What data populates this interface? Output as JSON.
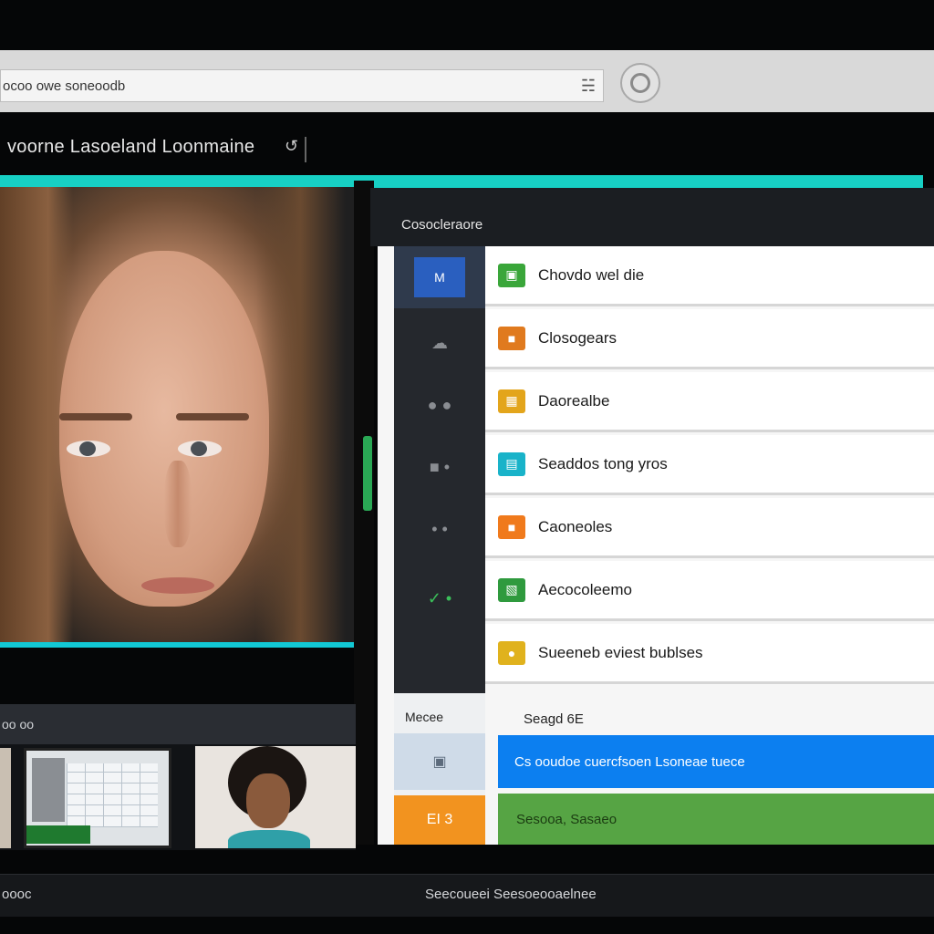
{
  "address_bar": {
    "text": "ocoo owe soneoodb"
  },
  "page_title": "voorne Lasoeland Loonmaine",
  "panel": {
    "header": "Cosocleraore",
    "items": [
      {
        "label": "Chovdo wel die",
        "icon": "green-card-icon",
        "color": "#3aa63a"
      },
      {
        "label": "Closogears",
        "icon": "folder-icon",
        "color": "#e07a1e"
      },
      {
        "label": "Daorealbe",
        "icon": "image-icon",
        "color": "#e3a51b"
      },
      {
        "label": "Seaddos tong yros",
        "icon": "cyan-doc-icon",
        "color": "#19b3c9"
      },
      {
        "label": "Caoneoles",
        "icon": "orange-square-icon",
        "color": "#f07a1c"
      },
      {
        "label": "Aecocoleemo",
        "icon": "photo-icon",
        "color": "#2f9a3e"
      },
      {
        "label": "Sueeneb eviest bublses",
        "icon": "user-icon",
        "color": "#e0b21d"
      }
    ],
    "rail_active_label": "M"
  },
  "lower_panel": {
    "left_label": "Mecee",
    "section_label": "Seagd 6E",
    "orange_label": "EI 3",
    "blue_row": "Cs ooudoe cuercfsoen Lsoneae tuece",
    "green_row": "Sesooa, Sasaeo"
  },
  "strip": {
    "label": "oo oo"
  },
  "status": {
    "left": "oooc",
    "center": "Seecoueei Seesoeooaelnee"
  }
}
